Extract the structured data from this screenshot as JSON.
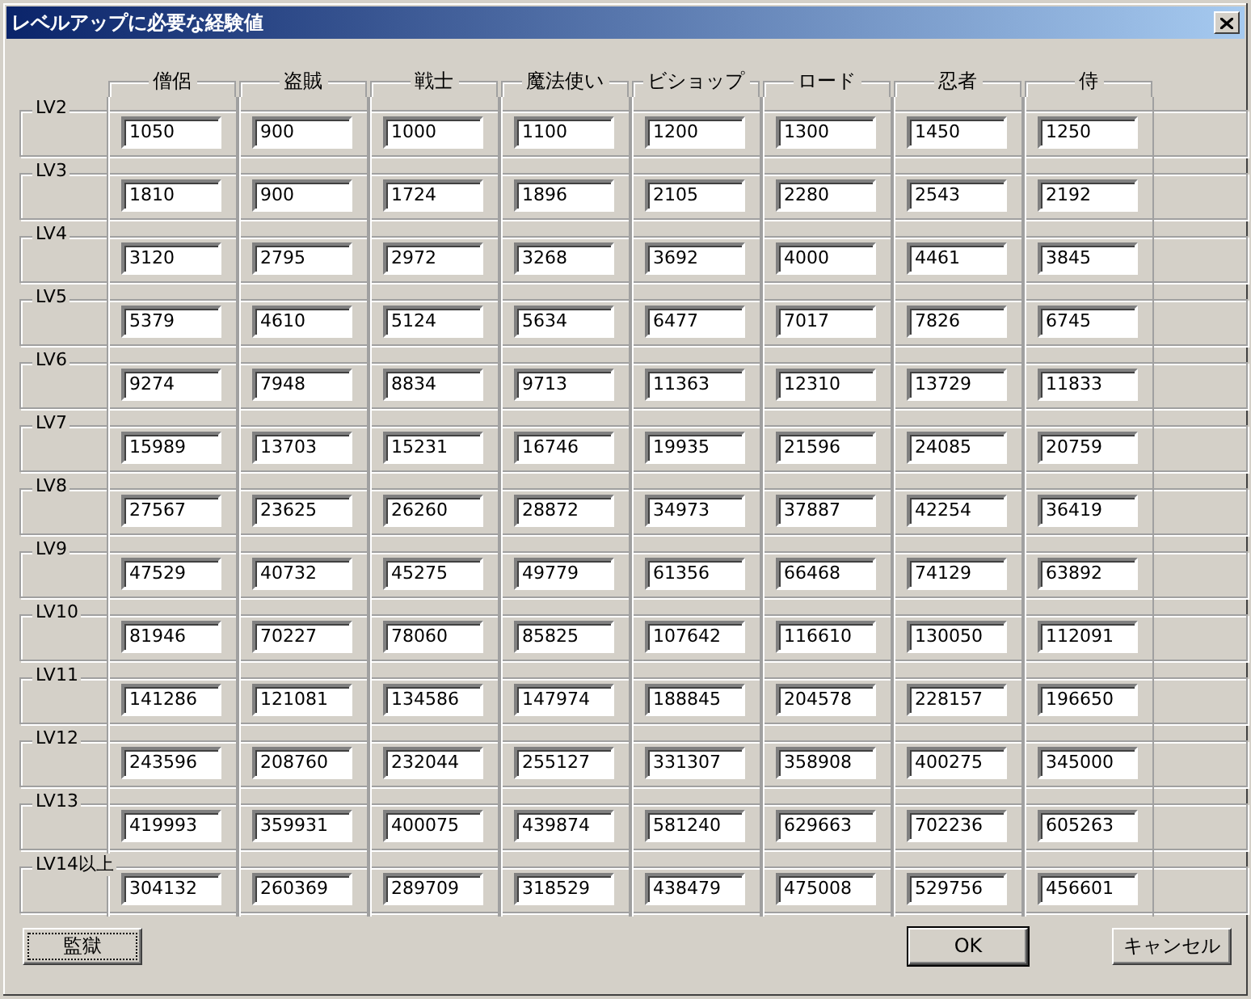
{
  "window": {
    "title": "レベルアップに必要な経験値"
  },
  "columns": [
    "僧侶",
    "盗賊",
    "戦士",
    "魔法使い",
    "ビショップ",
    "ロード",
    "忍者",
    "侍"
  ],
  "rows": [
    {
      "label": "LV2",
      "values": [
        "1050",
        "900",
        "1000",
        "1100",
        "1200",
        "1300",
        "1450",
        "1250"
      ]
    },
    {
      "label": "LV3",
      "values": [
        "1810",
        "900",
        "1724",
        "1896",
        "2105",
        "2280",
        "2543",
        "2192"
      ]
    },
    {
      "label": "LV4",
      "values": [
        "3120",
        "2795",
        "2972",
        "3268",
        "3692",
        "4000",
        "4461",
        "3845"
      ]
    },
    {
      "label": "LV5",
      "values": [
        "5379",
        "4610",
        "5124",
        "5634",
        "6477",
        "7017",
        "7826",
        "6745"
      ]
    },
    {
      "label": "LV6",
      "values": [
        "9274",
        "7948",
        "8834",
        "9713",
        "11363",
        "12310",
        "13729",
        "11833"
      ]
    },
    {
      "label": "LV7",
      "values": [
        "15989",
        "13703",
        "15231",
        "16746",
        "19935",
        "21596",
        "24085",
        "20759"
      ]
    },
    {
      "label": "LV8",
      "values": [
        "27567",
        "23625",
        "26260",
        "28872",
        "34973",
        "37887",
        "42254",
        "36419"
      ]
    },
    {
      "label": "LV9",
      "values": [
        "47529",
        "40732",
        "45275",
        "49779",
        "61356",
        "66468",
        "74129",
        "63892"
      ]
    },
    {
      "label": "LV10",
      "values": [
        "81946",
        "70227",
        "78060",
        "85825",
        "107642",
        "116610",
        "130050",
        "112091"
      ]
    },
    {
      "label": "LV11",
      "values": [
        "141286",
        "121081",
        "134586",
        "147974",
        "188845",
        "204578",
        "228157",
        "196650"
      ]
    },
    {
      "label": "LV12",
      "values": [
        "243596",
        "208760",
        "232044",
        "255127",
        "331307",
        "358908",
        "400275",
        "345000"
      ]
    },
    {
      "label": "LV13",
      "values": [
        "419993",
        "359931",
        "400075",
        "439874",
        "581240",
        "629663",
        "702236",
        "605263"
      ]
    },
    {
      "label": "LV14以上",
      "values": [
        "304132",
        "260369",
        "289709",
        "318529",
        "438479",
        "475008",
        "529756",
        "456601"
      ]
    }
  ],
  "buttons": [
    {
      "label": "監獄",
      "focused": true,
      "default": false
    },
    {
      "label": "OK",
      "focused": false,
      "default": true
    },
    {
      "label": "キャンセル",
      "focused": false,
      "default": false
    }
  ]
}
